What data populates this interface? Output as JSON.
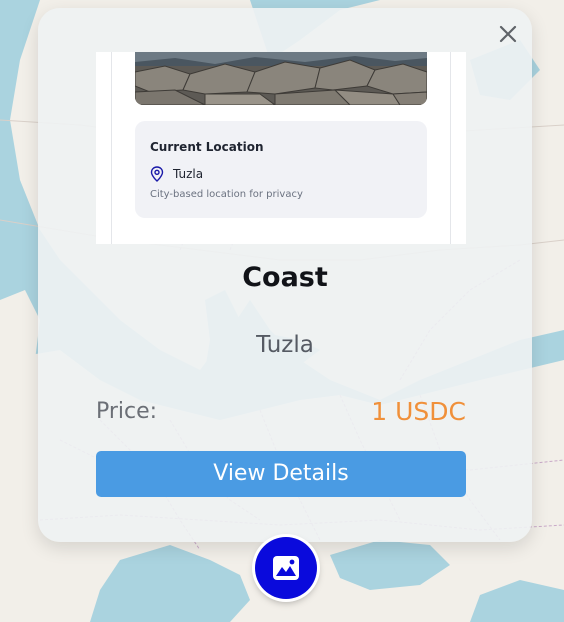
{
  "map": {
    "water_color": "#aad3df",
    "land_color": "#f2efe9",
    "border_color": "#c9a9c8"
  },
  "card": {
    "close_icon": "close-icon",
    "preview": {
      "location_title": "Current Location",
      "location_icon": "map-pin-icon",
      "location_name": "Tuzla",
      "location_note": "City-based location for privacy"
    },
    "title": "Coast",
    "subtitle": "Tuzla",
    "price_label": "Price:",
    "price_value": "1 USDC",
    "price_color": "#f0903a",
    "button_label": "View Details",
    "button_color": "#4a9be3"
  },
  "fab": {
    "icon": "image-gallery-icon",
    "color": "#0a0adc"
  }
}
